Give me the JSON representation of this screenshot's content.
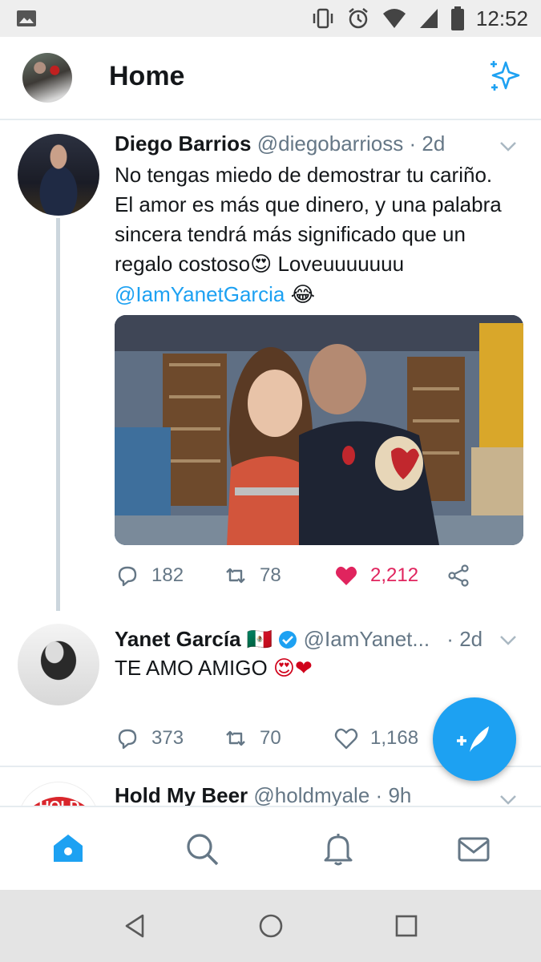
{
  "status_bar": {
    "time": "12:52"
  },
  "header": {
    "title": "Home"
  },
  "colors": {
    "accent": "#1da1f2",
    "like": "#e0245e",
    "muted": "#657786",
    "divider": "#e6ecf0"
  },
  "tweets": [
    {
      "name": "Diego Barrios",
      "handle": "@diegobarrioss",
      "separator": "·",
      "time": "2d",
      "text_lines": [
        "No tengas miedo de demostrar tu cariño.",
        "El amor es más que dinero, y una palabra",
        "sincera tendrá más significado que un"
      ],
      "text_line4": "regalo costoso",
      "emoji_love": "😍",
      "text_tail": " Loveuuuuuuu",
      "mention": "@IamYanetGarcia",
      "emoji_laugh": "😂",
      "replies": "182",
      "retweets": "78",
      "likes": "2,212",
      "liked": true
    },
    {
      "name": "Yanet García",
      "flag": "🇲🇽",
      "handle": "@IamYanet...",
      "separator": "·",
      "time": "2d",
      "text": "TE AMO AMIGO ",
      "emojis": "😍❤",
      "replies": "373",
      "retweets": "70",
      "likes": "1,168"
    },
    {
      "name": "Hold My Beer",
      "handle": "@holdmyale",
      "separator": "·",
      "time": "9h",
      "avatar_text": "HOLD"
    }
  ],
  "icons": {
    "gallery": "gallery-icon",
    "vibrate": "vibrate-icon",
    "alarm": "alarm-icon",
    "wifi": "wifi-icon",
    "signal": "signal-icon",
    "battery": "battery-icon",
    "sparkle": "sparkle-icon",
    "reply": "reply-icon",
    "retweet": "retweet-icon",
    "heart": "heart-icon",
    "share": "share-icon",
    "compose": "compose-icon",
    "home": "home-icon",
    "search": "search-icon",
    "notifications": "bell-icon",
    "messages": "mail-icon"
  }
}
